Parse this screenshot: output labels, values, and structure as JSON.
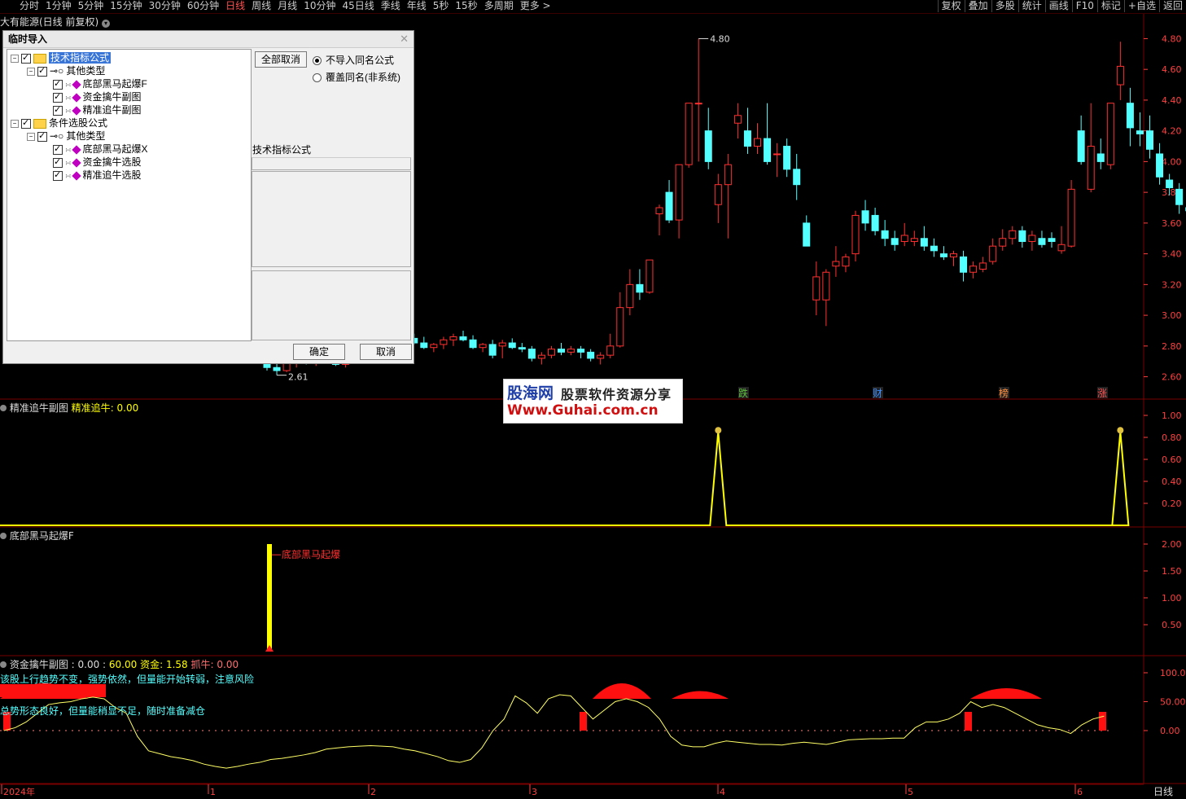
{
  "toolbar": {
    "periods": [
      "分时",
      "1分钟",
      "5分钟",
      "15分钟",
      "30分钟",
      "60分钟",
      "日线",
      "周线",
      "月线",
      "10分钟",
      "45日线",
      "季线",
      "年线",
      "5秒",
      "15秒",
      "多周期",
      "更多 >"
    ],
    "active_period": "日线",
    "right_buttons": [
      "复权",
      "叠加",
      "多股",
      "统计",
      "画线",
      "F10",
      "标记",
      "+自选",
      "返回"
    ]
  },
  "main_title": "大有能源(日线 前复权)",
  "price_axis": [
    "4.80",
    "4.60",
    "4.40",
    "4.20",
    "4.00",
    "3.80",
    "3.60",
    "3.40",
    "3.20",
    "3.00",
    "2.80",
    "2.60"
  ],
  "high_label": "4.80",
  "low_label": "2.61",
  "markers": [
    "跌",
    "财",
    "榜",
    "涨"
  ],
  "sub1": {
    "name": "精准追牛副图",
    "series": "精准追牛",
    "value": "0.00",
    "axis": [
      "1.00",
      "0.80",
      "0.60",
      "0.40",
      "0.20"
    ]
  },
  "sub2": {
    "name": "底部黑马起爆F",
    "signal_label": "底部黑马起爆",
    "axis": [
      "2.00",
      "1.50",
      "1.00",
      "0.50"
    ]
  },
  "sub3": {
    "name": "资金擒牛副图",
    "v1": "0.00",
    "v2": "60.00",
    "fund_label": "资金",
    "fund_value": "1.58",
    "bull_label": "抓牛",
    "bull_value": "0.00",
    "msg1": "该股上行趋势不变，强势依然，但量能开始转弱，注意风险",
    "msg2": "总势形态良好，但量能稍显不足，随时准备减仓",
    "axis": [
      "100.0",
      "50.00",
      "0.00"
    ]
  },
  "time_axis": [
    "2024年",
    "1",
    "2",
    "3",
    "4",
    "5",
    "6"
  ],
  "period_label": "日线",
  "dialog": {
    "title": "临时导入",
    "tree": [
      {
        "level": 0,
        "type": "folder",
        "label": "技术指标公式",
        "selected": true
      },
      {
        "level": 1,
        "type": "key",
        "label": "其他类型"
      },
      {
        "level": 2,
        "type": "item",
        "label": "底部黑马起爆F"
      },
      {
        "level": 2,
        "type": "item",
        "label": "资金擒牛副图"
      },
      {
        "level": 2,
        "type": "item",
        "label": "精准追牛副图"
      },
      {
        "level": 0,
        "type": "folder",
        "label": "条件选股公式"
      },
      {
        "level": 1,
        "type": "key",
        "label": "其他类型"
      },
      {
        "level": 2,
        "type": "item",
        "label": "底部黑马起爆X"
      },
      {
        "level": 2,
        "type": "item",
        "label": "资金擒牛选股"
      },
      {
        "level": 2,
        "type": "item",
        "label": "精准追牛选股"
      }
    ],
    "cancel_all": "全部取消",
    "radio1": "不导入同名公式",
    "radio2": "覆盖同名(非系统)",
    "info_label": "技术指标公式",
    "ok": "确定",
    "cancel": "取消"
  },
  "watermark": {
    "brand": "股海网",
    "slogan": "股票软件资源分享",
    "url": "Www.Guhai.com.cn"
  },
  "colors": {
    "up": "#ff3030",
    "down": "#54ffff",
    "yellow": "#ffff00",
    "grid": "#7a0000",
    "axis": "#ff4040"
  },
  "chart_data": {
    "type": "candlestick",
    "title": "大有能源(日线 前复权)",
    "ylim": [
      2.55,
      4.85
    ],
    "candles": [
      [
        2.74,
        2.76,
        2.64,
        2.66
      ],
      [
        2.66,
        2.7,
        2.61,
        2.64
      ],
      [
        2.64,
        2.72,
        2.63,
        2.7
      ],
      [
        2.7,
        2.73,
        2.66,
        2.72
      ],
      [
        2.72,
        2.75,
        2.68,
        2.7
      ],
      [
        2.7,
        2.76,
        2.67,
        2.74
      ],
      [
        2.74,
        2.76,
        2.69,
        2.7
      ],
      [
        2.7,
        2.74,
        2.67,
        2.68
      ],
      [
        2.68,
        2.72,
        2.66,
        2.71
      ],
      [
        2.71,
        2.78,
        2.7,
        2.76
      ],
      [
        2.76,
        2.8,
        2.73,
        2.75
      ],
      [
        2.75,
        2.83,
        2.74,
        2.82
      ],
      [
        2.82,
        2.86,
        2.79,
        2.8
      ],
      [
        2.8,
        2.84,
        2.77,
        2.83
      ],
      [
        2.83,
        2.86,
        2.8,
        2.85
      ],
      [
        2.85,
        2.88,
        2.81,
        2.82
      ],
      [
        2.82,
        2.86,
        2.78,
        2.79
      ],
      [
        2.79,
        2.82,
        2.76,
        2.81
      ],
      [
        2.81,
        2.86,
        2.78,
        2.84
      ],
      [
        2.84,
        2.88,
        2.8,
        2.86
      ],
      [
        2.86,
        2.9,
        2.83,
        2.84
      ],
      [
        2.84,
        2.87,
        2.78,
        2.79
      ],
      [
        2.79,
        2.82,
        2.76,
        2.81
      ],
      [
        2.81,
        2.84,
        2.72,
        2.74
      ],
      [
        2.8,
        2.84,
        2.72,
        2.82
      ],
      [
        2.82,
        2.85,
        2.78,
        2.79
      ],
      [
        2.79,
        2.82,
        2.76,
        2.78
      ],
      [
        2.78,
        2.8,
        2.7,
        2.72
      ],
      [
        2.72,
        2.76,
        2.68,
        2.74
      ],
      [
        2.74,
        2.8,
        2.72,
        2.78
      ],
      [
        2.78,
        2.82,
        2.74,
        2.76
      ],
      [
        2.76,
        2.8,
        2.74,
        2.78
      ],
      [
        2.78,
        2.8,
        2.72,
        2.76
      ],
      [
        2.76,
        2.78,
        2.7,
        2.72
      ],
      [
        2.72,
        2.76,
        2.68,
        2.74
      ],
      [
        2.74,
        2.88,
        2.72,
        2.8
      ],
      [
        2.8,
        3.15,
        2.79,
        3.05
      ],
      [
        3.05,
        3.3,
        3.0,
        3.2
      ],
      [
        3.2,
        3.3,
        3.1,
        3.15
      ],
      [
        3.15,
        3.36,
        3.14,
        3.36
      ],
      [
        3.66,
        3.72,
        3.52,
        3.7
      ],
      [
        3.8,
        3.88,
        3.6,
        3.62
      ],
      [
        3.62,
        3.98,
        3.5,
        3.98
      ],
      [
        3.98,
        4.38,
        3.96,
        4.38
      ],
      [
        4.38,
        4.8,
        4.0,
        4.38
      ],
      [
        4.2,
        4.35,
        3.95,
        4.0
      ],
      [
        3.72,
        3.92,
        3.6,
        3.85
      ],
      [
        3.85,
        4.05,
        3.5,
        3.98
      ],
      [
        4.25,
        4.38,
        4.15,
        4.3
      ],
      [
        4.2,
        4.35,
        4.05,
        4.1
      ],
      [
        4.1,
        4.25,
        4.05,
        4.15
      ],
      [
        4.15,
        4.38,
        3.98,
        4.0
      ],
      [
        4.05,
        4.12,
        3.9,
        4.05
      ],
      [
        4.1,
        4.15,
        3.9,
        3.95
      ],
      [
        3.95,
        4.05,
        3.75,
        3.85
      ],
      [
        3.6,
        3.65,
        3.45,
        3.45
      ],
      [
        3.1,
        3.35,
        3.0,
        3.25
      ],
      [
        3.1,
        3.3,
        2.93,
        3.28
      ],
      [
        3.32,
        3.45,
        3.25,
        3.35
      ],
      [
        3.32,
        3.4,
        3.28,
        3.38
      ],
      [
        3.4,
        3.68,
        3.35,
        3.65
      ],
      [
        3.68,
        3.75,
        3.55,
        3.6
      ],
      [
        3.65,
        3.7,
        3.52,
        3.55
      ],
      [
        3.55,
        3.62,
        3.45,
        3.5
      ],
      [
        3.5,
        3.55,
        3.42,
        3.46
      ],
      [
        3.48,
        3.6,
        3.45,
        3.52
      ],
      [
        3.48,
        3.55,
        3.45,
        3.5
      ],
      [
        3.5,
        3.58,
        3.42,
        3.45
      ],
      [
        3.45,
        3.5,
        3.38,
        3.42
      ],
      [
        3.4,
        3.45,
        3.36,
        3.38
      ],
      [
        3.38,
        3.42,
        3.32,
        3.4
      ],
      [
        3.38,
        3.42,
        3.22,
        3.28
      ],
      [
        3.28,
        3.35,
        3.24,
        3.32
      ],
      [
        3.3,
        3.38,
        3.28,
        3.34
      ],
      [
        3.35,
        3.5,
        3.33,
        3.45
      ],
      [
        3.45,
        3.56,
        3.42,
        3.5
      ],
      [
        3.5,
        3.58,
        3.46,
        3.55
      ],
      [
        3.55,
        3.58,
        3.44,
        3.48
      ],
      [
        3.48,
        3.55,
        3.42,
        3.52
      ],
      [
        3.5,
        3.55,
        3.44,
        3.46
      ],
      [
        3.5,
        3.54,
        3.44,
        3.48
      ],
      [
        3.42,
        3.58,
        3.4,
        3.46
      ],
      [
        3.45,
        3.88,
        3.44,
        3.82
      ],
      [
        4.2,
        4.3,
        3.98,
        4.0
      ],
      [
        3.82,
        4.38,
        3.8,
        4.1
      ],
      [
        4.05,
        4.15,
        3.95,
        4.0
      ],
      [
        3.98,
        4.38,
        3.95,
        4.38
      ],
      [
        4.5,
        4.78,
        4.4,
        4.62
      ],
      [
        4.38,
        4.48,
        4.1,
        4.22
      ],
      [
        4.2,
        4.32,
        4.1,
        4.18
      ],
      [
        4.2,
        4.3,
        4.02,
        4.08
      ],
      [
        4.05,
        4.12,
        3.85,
        3.9
      ],
      [
        3.88,
        3.92,
        3.78,
        3.83
      ],
      [
        3.82,
        3.86,
        3.66,
        3.72
      ],
      [
        3.7,
        3.76,
        3.62,
        3.68
      ],
      [
        3.72,
        3.8,
        3.62,
        3.76
      ],
      [
        3.75,
        3.8,
        3.7,
        3.74
      ],
      [
        3.78,
        4.1,
        3.76,
        4.1
      ],
      [
        4.02,
        4.06,
        3.94,
        4.0
      ]
    ],
    "sub1_spikes": [
      46,
      87
    ],
    "sub2_signal_bar": 16,
    "sub3_line": [
      0,
      5,
      15,
      30,
      45,
      48,
      50,
      55,
      58,
      55,
      40,
      30,
      -10,
      -35,
      -40,
      -45,
      -48,
      -52,
      -58,
      -62,
      -65,
      -62,
      -58,
      -55,
      -50,
      -48,
      -45,
      -42,
      -38,
      -32,
      -30,
      -28,
      -27,
      -26,
      -27,
      -28,
      -32,
      -35,
      -40,
      -45,
      -52,
      -55,
      -50,
      -30,
      0,
      20,
      60,
      48,
      30,
      55,
      62,
      60,
      40,
      20,
      35,
      50,
      55,
      50,
      40,
      20,
      -10,
      -25,
      -28,
      -28,
      -22,
      -18,
      -20,
      -22,
      -24,
      -24,
      -25,
      -22,
      -20,
      -22,
      -24,
      -20,
      -16,
      -15,
      -14,
      -14,
      -13,
      -13,
      5,
      15,
      15,
      20,
      30,
      50,
      40,
      45,
      40,
      30,
      20,
      10,
      5,
      2,
      -5,
      10,
      20,
      25
    ]
  }
}
